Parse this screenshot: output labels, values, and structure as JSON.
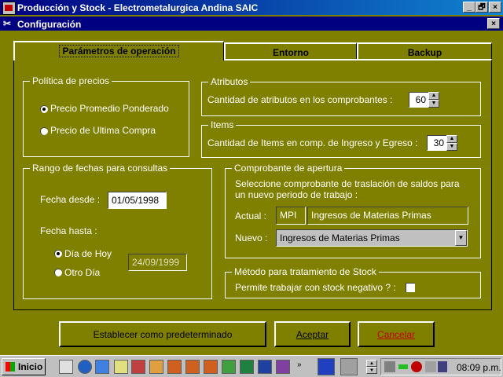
{
  "app": {
    "title": "Producción y Stock - Electrometalurgica Andina SAIC",
    "controls": [
      "_",
      "🗗",
      "×"
    ]
  },
  "dialog": {
    "title": "Configuración",
    "close": "×"
  },
  "tabs": [
    {
      "label": "Parámetros de operación",
      "active": true
    },
    {
      "label": "Entorno",
      "active": false
    },
    {
      "label": "Backup",
      "active": false
    }
  ],
  "politica": {
    "legend": "Política de precios",
    "options": [
      {
        "label": "Precio Promedio Ponderado",
        "selected": true
      },
      {
        "label": "Precio de Ultima Compra",
        "selected": false
      }
    ]
  },
  "atributos": {
    "legend": "Atributos",
    "label": "Cantidad de atributos en los comprobantes :",
    "value": "60"
  },
  "items": {
    "legend": "Items",
    "label": "Cantidad de Items en comp. de Ingreso y Egreso :",
    "value": "30"
  },
  "rango": {
    "legend": "Rango de fechas para consultas",
    "desde_label": "Fecha desde :",
    "desde_value": "01/05/1998",
    "hasta_label": "Fecha hasta :",
    "options": [
      {
        "label": "Día de Hoy",
        "selected": true
      },
      {
        "label": "Otro Día",
        "selected": false
      }
    ],
    "otro_value": "24/09/1999"
  },
  "apertura": {
    "legend": "Comprobante de apertura",
    "instruction_line1": "Seleccione comprobante de traslación de saldos para",
    "instruction_line2": "un nuevo periodo de trabajo :",
    "actual_label": "Actual :",
    "actual_code": "MPI",
    "actual_desc": "Ingresos de Materias Primas",
    "nuevo_label": "Nuevo :",
    "nuevo_value": "Ingresos de Materias Primas"
  },
  "stock": {
    "legend": "Método para tratamiento de Stock",
    "label": "Permite trabajar con stock negativo ? :",
    "checked": false
  },
  "buttons": {
    "default": "Establecer como predeterminado",
    "accept": "Aceptar",
    "cancel": "Cancelar"
  },
  "taskbar": {
    "start": "Inicio",
    "clock": "08:09 p.m."
  },
  "colors": {
    "face": "#808000",
    "title": "#000080",
    "cancel_text": "#c00000"
  }
}
